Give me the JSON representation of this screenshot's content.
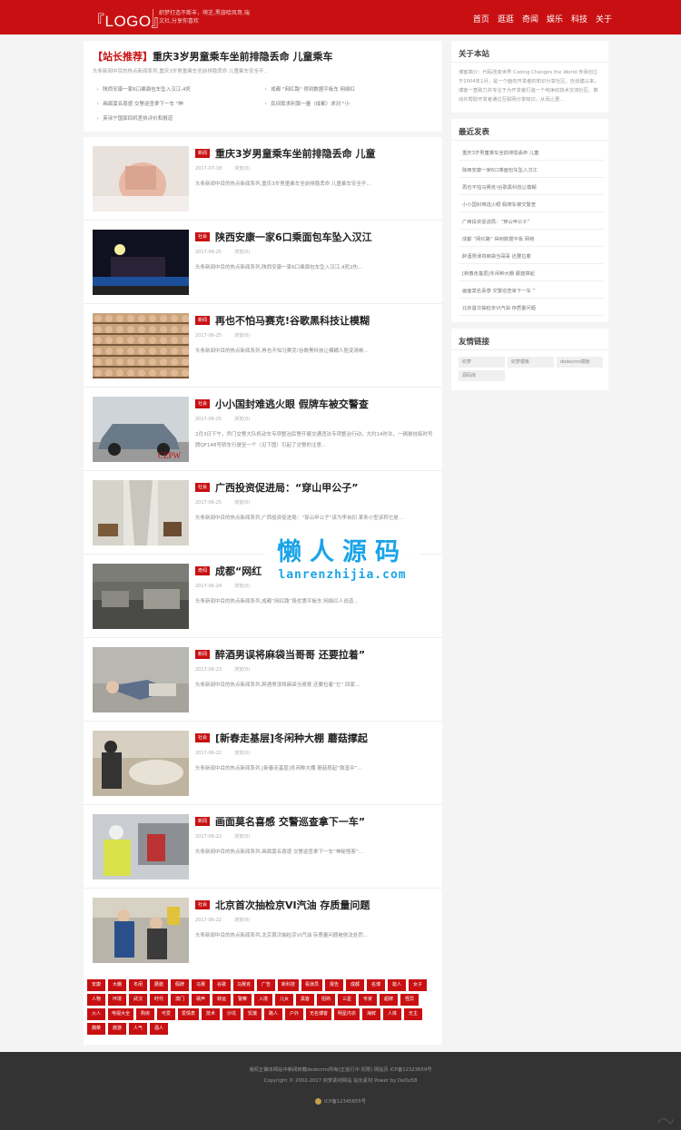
{
  "header": {
    "logo": "『LOGO』",
    "slogan": "织梦打造不断丰，萌芝,黑旅哈风哥,瑞文社,分享你喜欢",
    "nav": [
      "首页",
      "逛逛",
      "奇闻",
      "娱乐",
      "科技",
      "关于"
    ]
  },
  "recommend": {
    "tag": "【站长推荐】",
    "title": "重庆3岁男童乘车坐前排隐丢命 儿童乘车",
    "desc": "头条新闻中目的热点新闻系列,重庆3岁男童乘车坐前排隐丢命 儿童乘车安全不..",
    "items": [
      "陕西安康一家6口乘面包车坠入汉江,4死",
      "成都 \"网红路\" 得到数据平板车 网络红",
      "画面莫名喜感 交警巡查拿下一车 \"神",
      "民间取求利算一量（成都）求对 \"小",
      "英涂宁国家四机差执评价和报道"
    ]
  },
  "articles": [
    {
      "cat": "新闻",
      "title": "重庆3岁男童乘车坐前排隐丢命 儿童",
      "date": "2017-07-18",
      "views": "浏览(0)",
      "summary": "头条新闻中目的热点新闻系列,重庆3岁男童乘车坐前排隐丢命 儿童乘车安全不..."
    },
    {
      "cat": "社会",
      "title": "陕西安康一家6口乘面包车坠入汉江",
      "date": "2017-06-25",
      "views": "浏览(0)",
      "summary": "头条新闻中目的热点新闻系列,陕西安康一家6口乘面包车坠入汉江,4死2伤..."
    },
    {
      "cat": "新闻",
      "title": "再也不怕马赛克!谷歌黑科技让模糊",
      "date": "2017-06-25",
      "views": "浏览(0)",
      "summary": "头条新闻中目的热点新闻系列,再也不怕马赛克!谷歌黑科技让模糊人脸变清晰..."
    },
    {
      "cat": "社会",
      "title": "小小国封难逃火眼 假牌车被交警查",
      "date": "2017-06-25",
      "views": "浏览(0)",
      "summary": "2月3日下午，乔门交警大队机动车专项整治民警开展交通违法专项整治行动，大约14时许，一辆悬挂临时号牌QF148号轿车行驶至一个（见下图）引起了交警的注意..."
    },
    {
      "cat": "社会",
      "title": "广西投资促进局：“穿山甲公子”",
      "date": "2017-06-25",
      "views": "浏览(0)",
      "summary": "头条新闻中目的热点新闻系列,广西投资促进局：“穿山甲公子”该为李自扣 某条小型该称它是..."
    },
    {
      "cat": "奇闻",
      "title": "成都“网红",
      "date": "2017-06-24",
      "views": "浏览(0)",
      "summary": "头条新闻中目的热点新闻系列,成都“网红路”段优惠平板车 网络红人说道..."
    },
    {
      "cat": "新闻",
      "title": "醉酒男误将麻袋当哥哥 还要拉着”",
      "date": "2017-06-23",
      "views": "浏览(0)",
      "summary": "头条新闻中目的热点新闻系列,醉酒男误将麻袋当哥哥 还要拉着“它” 回家..."
    },
    {
      "cat": "社会",
      "title": "[新春走基层]冬闲种大棚 蘑菇撑起",
      "date": "2017-06-22",
      "views": "浏览(0)",
      "summary": "头条新闻中目的热点新闻系列,[新春走基层]冬闲种大棚 蘑菇撑起“致富伞”..."
    },
    {
      "cat": "新闻",
      "title": "画面莫名喜感 交警巡查拿下一车”",
      "date": "2017-06-22",
      "views": "浏览(0)",
      "summary": "头条新闻中目的热点新闻系列,画面莫名喜感 交警巡查拿下一车“神秘怪客”..."
    },
    {
      "cat": "社会",
      "title": "北京首次抽检京VI汽油 存质量问题",
      "date": "2017-06-22",
      "views": "浏览(0)",
      "summary": "头条新闻中目的热点新闻系列,北京首次抽检京VI汽油 存质量问题被依法处罚..."
    }
  ],
  "tags": [
    "安康",
    "大棚",
    "冬闲",
    "蘑菇",
    "假牌",
    "马赛",
    "谷歌",
    "马赛克",
    "广告",
    "新科技",
    "看演员",
    "报告",
    "成都",
    "名博",
    "能人",
    "女子",
    "人物",
    "环境",
    "武汉",
    "时代",
    "澳门",
    "歌声",
    "转运",
    "警察",
    "入境",
    "儿女",
    "黑客",
    "招商",
    "三星",
    "专家",
    "超牌",
    "怪异",
    "火人",
    "电视大全",
    "购房",
    "可爱",
    "爱情表",
    "技术",
    "沙坑",
    "饥饿",
    "路人",
    "户外",
    "无名博客",
    "明星内衣",
    "海鲜",
    "人体",
    "无主",
    "蔬菜",
    "旅游",
    "人气",
    "酒人"
  ],
  "sidebar": {
    "about_title": "关于本站",
    "about_text": "博客简介：代码改变世界 Coding Changes the World 传承创立于2004年1月，是一个面向开发者的知识分享社区。自创建以来，博客一直致力并专注于为开发者打造一个纯净的技术交流社区，推动并帮助开发者通过互联网分享知识，从而让更...",
    "recent_title": "最近发表",
    "recent": [
      "重庆3岁男童乘车坐前排隐丢命 儿童",
      "陕西安康一家6口乘面包车坠入汉江",
      "再也不怕马赛克!谷歌黑科技让模糊",
      "小小国封难逃火眼 假牌车被交警查",
      "广西投资促进局：“穿山甲公子”",
      "成都 “网红路” 得到数据平板 网络",
      "醉酒男误将麻袋当哥哥 还要拉着",
      "[新春走基层]冬闲种大棚 蘑菇撑起",
      "画面莫名喜感 交警巡查拿下一车 ”",
      "北京首次抽检京VI汽油 存质量问题"
    ],
    "friends_title": "友情链接",
    "friends": [
      "织梦",
      "织梦模板",
      "dedecms模板",
      "源码库"
    ]
  },
  "footer": {
    "line1": "版权正确本网站中新闻转载dedecms所有(正进行中 权限) 网站页 ICP备12323659号",
    "line2": "Copyright © 2002-2017 织梦素材网站 站长素材 Power by DeDe58",
    "line3": "ICP备12345655号"
  },
  "watermark": {
    "cn": "懒人源码",
    "en": "lanrenzhijia.com"
  }
}
